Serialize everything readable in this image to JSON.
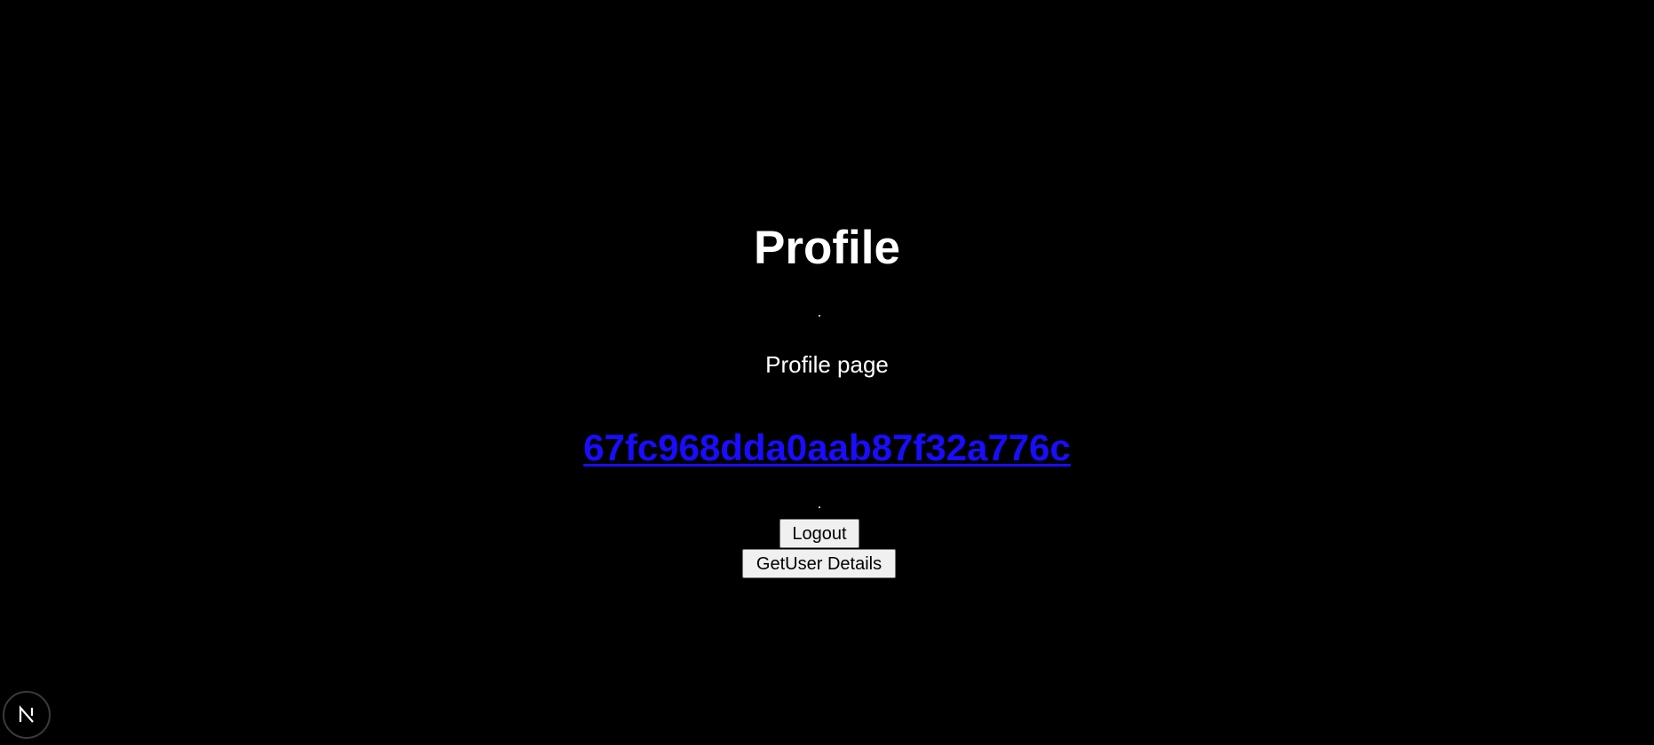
{
  "main": {
    "title": "Profile",
    "subtitle": "Profile page",
    "user_id_link": "67fc968dda0aab87f32a776c",
    "logout_label": "Logout",
    "get_user_details_label": "GetUser Details"
  },
  "colors": {
    "background": "#000000",
    "text": "#ffffff",
    "link": "#1a0dff",
    "button_bg": "#f0f0f0"
  },
  "icons": {
    "dev_badge": "nextjs-logo-icon"
  }
}
